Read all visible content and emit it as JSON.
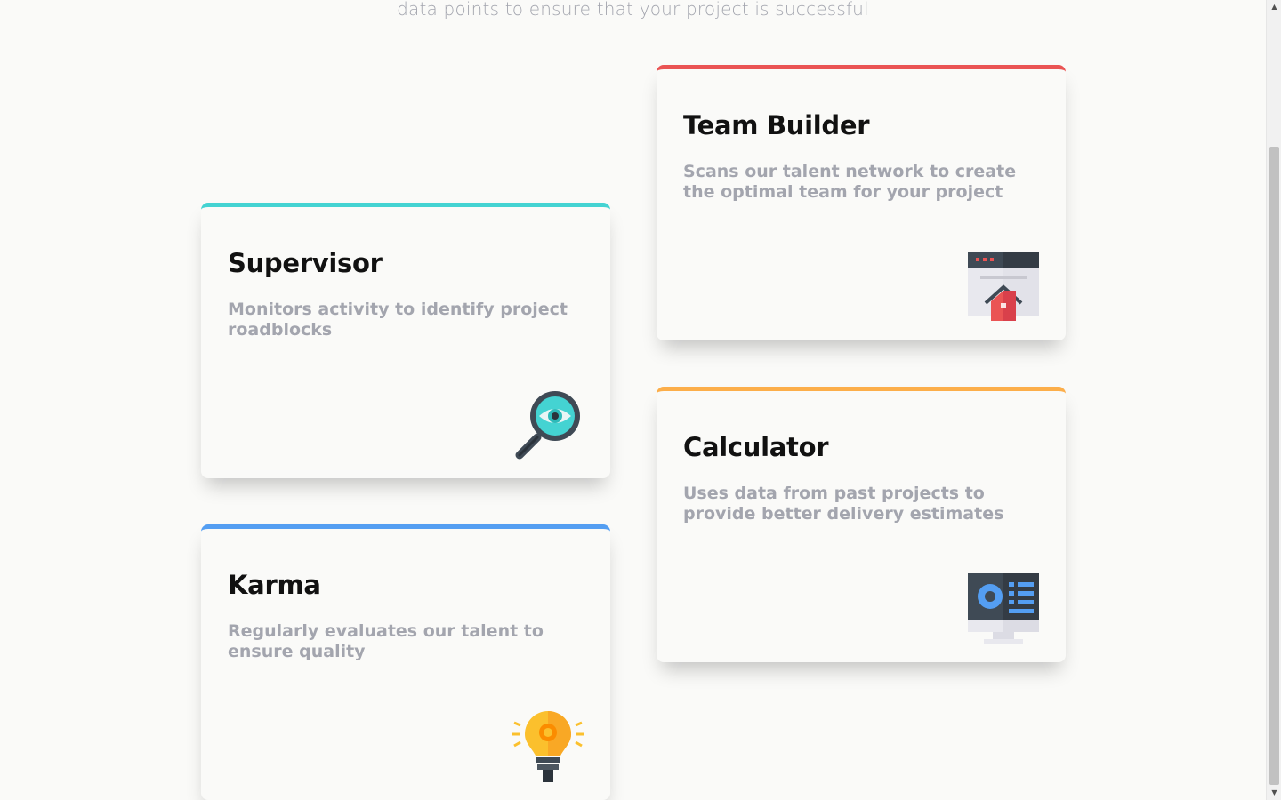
{
  "intro_text": "data points to ensure that your project is successful",
  "cards": [
    {
      "title": "Supervisor",
      "description": "Monitors activity to identify project roadblocks",
      "accent": "#44d3d2",
      "icon": "magnifier-eye-icon"
    },
    {
      "title": "Team Builder",
      "description": "Scans our talent network to create the optimal team for your project",
      "accent": "#ea5454",
      "icon": "browser-home-icon"
    },
    {
      "title": "Karma",
      "description": "Regularly evaluates our talent to ensure quality",
      "accent": "#549ef2",
      "icon": "lightbulb-icon"
    },
    {
      "title": "Calculator",
      "description": "Uses data from past projects to provide better delivery estimates",
      "accent": "#fcae4a",
      "icon": "monitor-chart-icon"
    }
  ],
  "scrollbar": {
    "up_arrow": "▲",
    "down_arrow": "▼"
  }
}
